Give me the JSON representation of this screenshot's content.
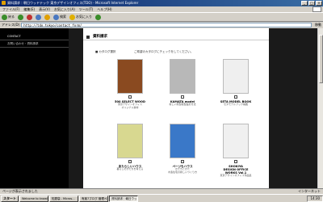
{
  "window": {
    "title": "資料請求｜朝日ウッドテック 東京デザインオフィス(TDO) - Microsoft Internet Explorer",
    "minimize": "_",
    "maximize": "□",
    "close": "×"
  },
  "menu": [
    "ファイル(F)",
    "編集(E)",
    "表示(V)",
    "お気に入り(A)",
    "ツール(T)",
    "ヘルプ(H)"
  ],
  "toolbar": [
    {
      "label": "戻る",
      "color": "#3a8d2a"
    },
    {
      "label": "",
      "color": "#3a8d2a"
    },
    {
      "label": "",
      "color": "#c03030"
    },
    {
      "label": "",
      "color": "#4a78c0"
    },
    {
      "label": "",
      "color": "#e0a000"
    },
    {
      "label": "検索",
      "color": "#4a78c0"
    },
    {
      "label": "お気に入り",
      "color": "#e0b000"
    },
    {
      "label": "",
      "color": "#3a8d2a"
    }
  ],
  "address": {
    "label": "アドレス(D)",
    "url": "http://tdo.tokyo/contact_form/",
    "go": "移動"
  },
  "sidebar": [
    {
      "label": "CONTACT",
      "active": true
    },
    {
      "label": "お問い合わせ・資料請求",
      "active": false
    }
  ],
  "content": {
    "header": "資料請求",
    "section_label": "■ カタログ選択",
    "intro": "ご希望のカタログにチェックをしてください。",
    "books": [
      {
        "title": "500 SELECT WOOD",
        "sub": "東京デザインオフィス\nオリジナル素材",
        "cover": "#8a4a20"
      },
      {
        "title": "KAMATA model",
        "sub": "新しい家型模型設計方法",
        "cover": "#b8b8b8"
      },
      {
        "title": "SETA MODEL BOOK",
        "sub": "セタモデルブック掲載",
        "cover": "#efefef"
      },
      {
        "title": "あたらしいハウス",
        "sub": "暮らしのかたちを考える",
        "cover": "#d8d890"
      },
      {
        "title": "ページもハウス",
        "sub": "かたちとかた\n木造住宅の新しいつくり方",
        "cover": "#3a78c8"
      },
      {
        "title": "SHOKIYA\nDESIGN OFFICE\nWORKS Vol.1",
        "sub": "東京デザインオフィス作品集",
        "cover": "#f0f0f0"
      }
    ]
  },
  "status": {
    "text": "ページが表示されました",
    "zone": "インターネット"
  },
  "taskbar": {
    "start": "スタート",
    "tasks": [
      "Welcome to knowledge...",
      "知恵袋 - Micros...",
      "有楽7ブログ 管理ページ...",
      "資料請求｜朝日ウッド..."
    ],
    "clock": "14:30"
  }
}
